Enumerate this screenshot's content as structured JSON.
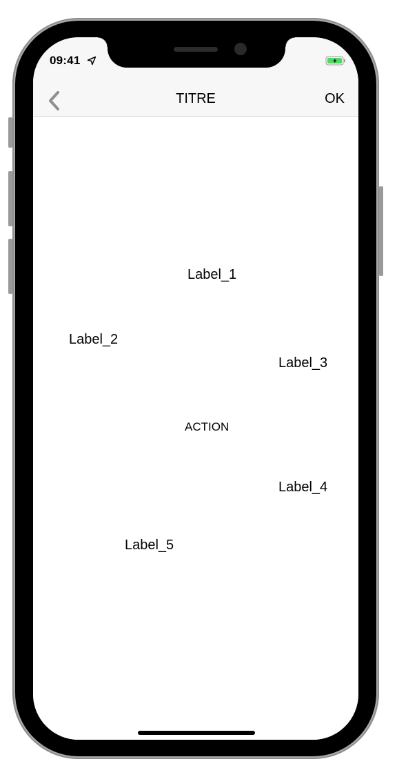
{
  "status_bar": {
    "time": "09:41",
    "location_icon": "location-arrow-icon",
    "battery_icon": "battery-charging-icon",
    "battery_color": "#4cd964"
  },
  "nav_bar": {
    "back_icon": "chevron-left-icon",
    "title": "TITRE",
    "ok_label": "OK",
    "back_color": "#8e8e93"
  },
  "content": {
    "label_1": "Label_1",
    "label_2": "Label_2",
    "label_3": "Label_3",
    "label_4": "Label_4",
    "label_5": "Label_5",
    "action_label": "ACTION"
  }
}
